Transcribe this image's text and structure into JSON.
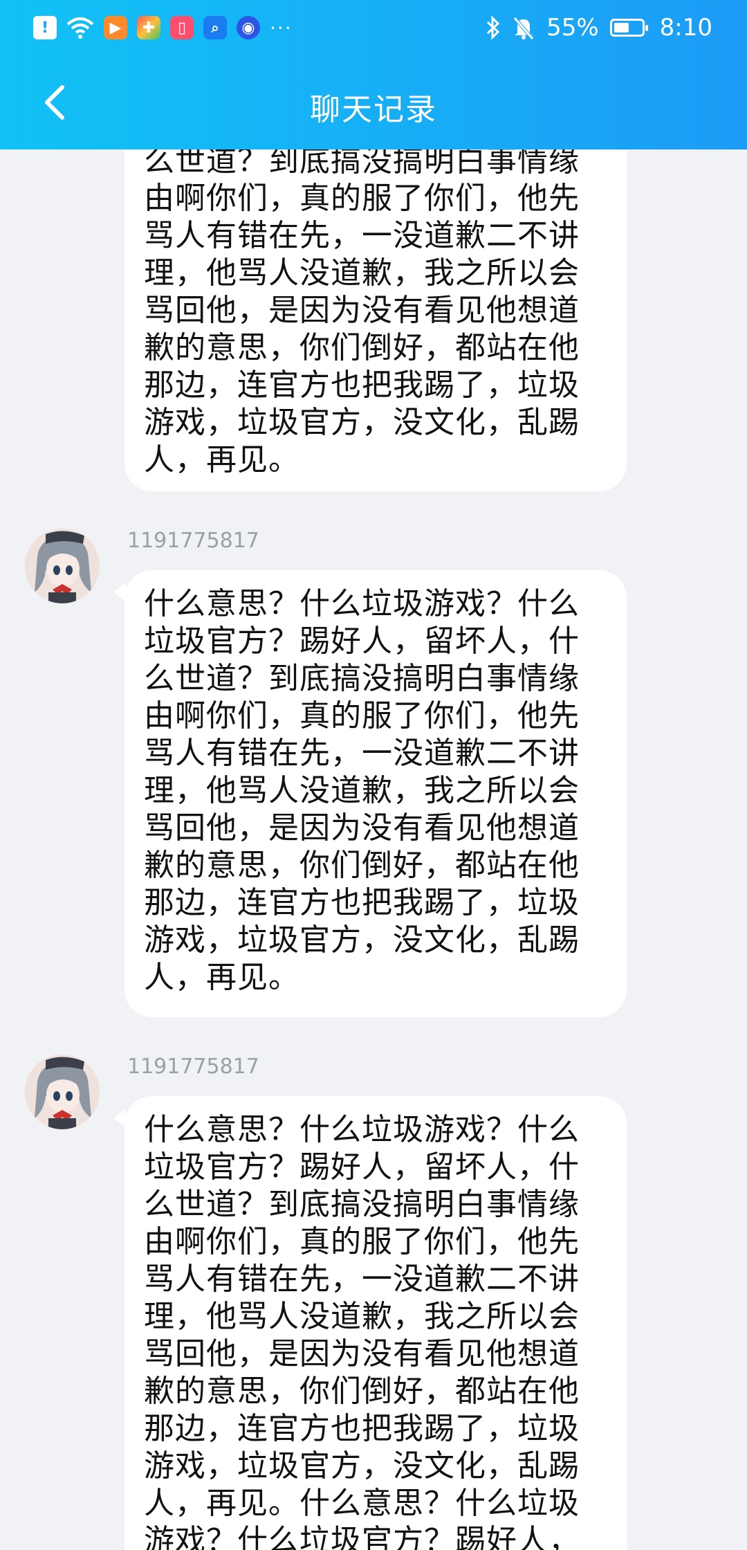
{
  "status_bar": {
    "battery_percent": "55%",
    "battery_level": 0.55,
    "time": "8:10",
    "overflow": "···"
  },
  "header": {
    "title": "聊天记录"
  },
  "messages": [
    {
      "sender": "",
      "text": "么世道？到底搞没搞明白事情缘\n由啊你们，真的服了你们，他先\n骂人有错在先，一没道歉二不讲\n理，他骂人没道歉，我之所以会\n骂回他，是因为没有看见他想道\n歉的意思，你们倒好，都站在他\n那边，连官方也把我踢了，垃圾\n游戏，垃圾官方，没文化，乱踢\n人，再见。"
    },
    {
      "sender": "1191775817",
      "text": "什么意思？什么垃圾游戏？什么\n垃圾官方？踢好人，留坏人，什\n么世道？到底搞没搞明白事情缘\n由啊你们，真的服了你们，他先\n骂人有错在先，一没道歉二不讲\n理，他骂人没道歉，我之所以会\n骂回他，是因为没有看见他想道\n歉的意思，你们倒好，都站在他\n那边，连官方也把我踢了，垃圾\n游戏，垃圾官方，没文化，乱踢\n人，再见。"
    },
    {
      "sender": "1191775817",
      "text": "什么意思？什么垃圾游戏？什么\n垃圾官方？踢好人，留坏人，什\n么世道？到底搞没搞明白事情缘\n由啊你们，真的服了你们，他先\n骂人有错在先，一没道歉二不讲\n理，他骂人没道歉，我之所以会\n骂回他，是因为没有看见他想道\n歉的意思，你们倒好，都站在他\n那边，连官方也把我踢了，垃圾\n游戏，垃圾官方，没文化，乱踢\n人，再见。什么意思？什么垃圾\n游戏？什么垃圾官方？踢好人，"
    }
  ],
  "colors": {
    "header_start": "#11c2f5",
    "header_end": "#1c9cf7",
    "background": "#f1f2f6",
    "bubble": "#ffffff",
    "sender_text": "#9aa0a8"
  }
}
